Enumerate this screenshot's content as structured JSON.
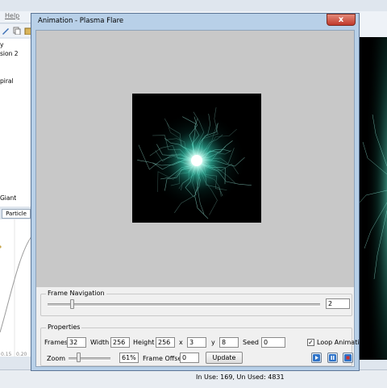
{
  "background_app": {
    "menu_help": "Help",
    "tree_items": [
      "y",
      "sion 2",
      "",
      "piral",
      "",
      "",
      "",
      "Giant"
    ],
    "particle_tab": "Particle",
    "axis_labels": [
      "0.15",
      "0.20"
    ],
    "status_text": "In Use: 169, Un Used: 4831"
  },
  "dialog": {
    "title": "Animation - Plasma Flare",
    "close_glyph": "x",
    "frame_navigation": {
      "group_label": "Frame Navigation",
      "frame_value": "2"
    },
    "properties": {
      "group_label": "Properties",
      "frames_label": "Frames",
      "frames_value": "32",
      "width_label": "Width",
      "width_value": "256",
      "height_label": "Height",
      "height_value": "256",
      "x_label": "x",
      "x_value": "3",
      "y_label": "y",
      "y_value": "8",
      "seed_label": "Seed",
      "seed_value": "0",
      "loop_label": "Loop Animation",
      "loop_checked": true,
      "zoom_label": "Zoom",
      "zoom_value": "61%",
      "frame_offset_label": "Frame Offset",
      "frame_offset_value": "0",
      "update_label": "Update"
    }
  },
  "colors": {
    "flare_core": "#ffffff",
    "flare_glow": "#3cf0d2",
    "close_button": "#c0392b",
    "window_frame": "#b8d0e8"
  },
  "icons": [
    "play-icon",
    "pause-icon",
    "stop-icon",
    "close-icon"
  ]
}
